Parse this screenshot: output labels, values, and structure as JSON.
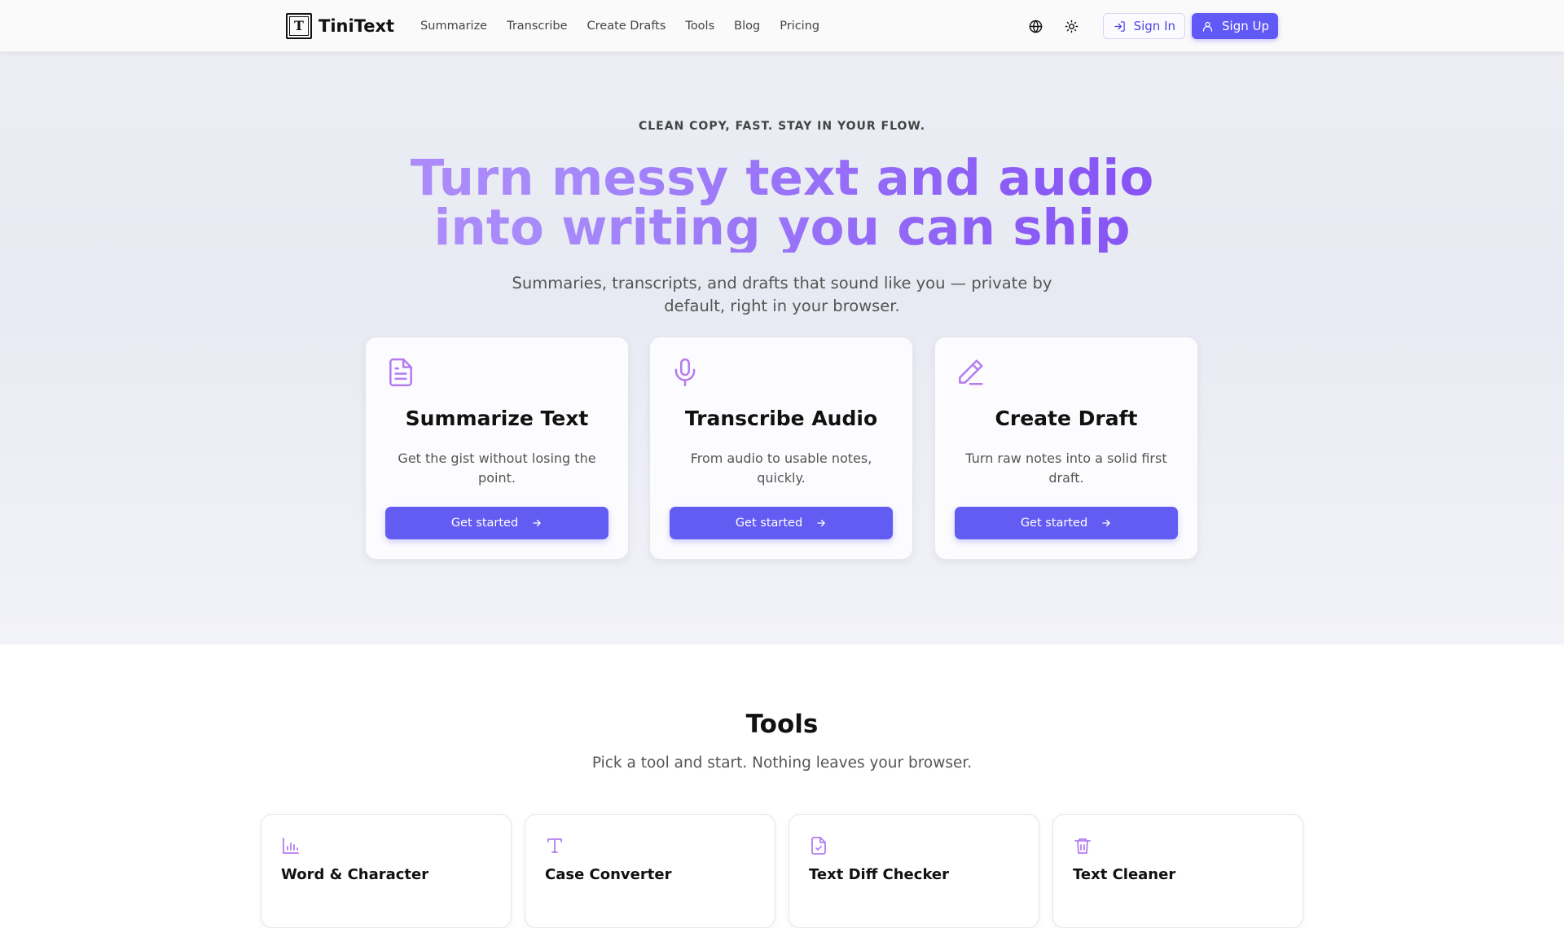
{
  "header": {
    "logo_text": "TiniText",
    "logo_letter": "T",
    "nav": [
      {
        "label": "Summarize"
      },
      {
        "label": "Transcribe"
      },
      {
        "label": "Create Drafts"
      },
      {
        "label": "Tools"
      },
      {
        "label": "Blog"
      },
      {
        "label": "Pricing"
      }
    ],
    "language_icon": "globe-icon",
    "theme_icon": "sun-icon",
    "sign_in_label": "Sign In",
    "sign_up_label": "Sign Up"
  },
  "hero": {
    "tagline": "CLEAN COPY, FAST. STAY IN YOUR FLOW.",
    "title_line1": "Turn messy text and audio",
    "title_line2": "into writing you can ship",
    "subtitle": "Summaries, transcripts, and drafts that sound like you — private by default, right in your browser.",
    "cards": [
      {
        "icon": "document-icon",
        "title": "Summarize Text",
        "description": "Get the gist without losing the point.",
        "button": "Get started"
      },
      {
        "icon": "microphone-icon",
        "title": "Transcribe Audio",
        "description": "From audio to usable notes, quickly.",
        "button": "Get started"
      },
      {
        "icon": "pencil-icon",
        "title": "Create Draft",
        "description": "Turn raw notes into a solid first draft.",
        "button": "Get started"
      }
    ]
  },
  "tools": {
    "title": "Tools",
    "subtitle": "Pick a tool and start. Nothing leaves your browser.",
    "items": [
      {
        "icon": "bar-chart-icon",
        "title": "Word & Character"
      },
      {
        "icon": "text-type-icon",
        "title": "Case Converter"
      },
      {
        "icon": "file-check-icon",
        "title": "Text Diff Checker"
      },
      {
        "icon": "trash-icon",
        "title": "Text Cleaner"
      }
    ]
  },
  "colors": {
    "accent": "#625cf3",
    "icon_purple": "#b57cf0",
    "title_gradient_start": "#c084fc",
    "title_gradient_end": "#7c3aed"
  }
}
